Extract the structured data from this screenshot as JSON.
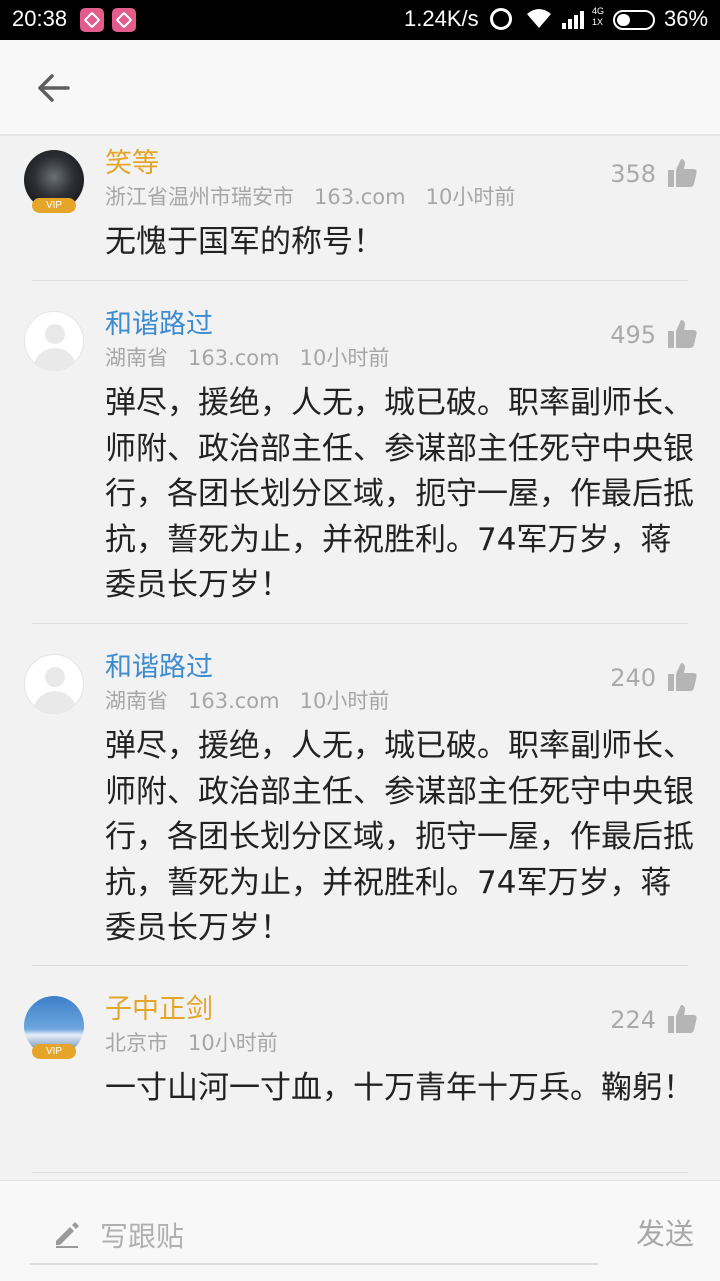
{
  "status_bar": {
    "time": "20:38",
    "net_speed": "1.24K/s",
    "network_type": "4G",
    "sim": "1X",
    "battery": "36%"
  },
  "header": {
    "back_icon": "arrow-left-icon"
  },
  "comments": [
    {
      "user": "笑等",
      "user_color": "#e5a52a",
      "vip": "VIP",
      "location": "浙江省温州市瑞安市",
      "source": "163.com",
      "time": "10小时前",
      "likes": "358",
      "text": "无愧于国军的称号！"
    },
    {
      "user": "和谐路过",
      "user_color": "#3e8cd0",
      "location": "湖南省",
      "source": "163.com",
      "time": "10小时前",
      "likes": "495",
      "text": "弹尽，援绝，人无，城已破。职率副师长、师附、政治部主任、参谋部主任死守中央银行，各团长划分区域，扼守一屋，作最后抵抗，誓死为止，并祝胜利。74军万岁，蒋委员长万岁！"
    },
    {
      "user": "和谐路过",
      "user_color": "#3e8cd0",
      "location": "湖南省",
      "source": "163.com",
      "time": "10小时前",
      "likes": "240",
      "text": "弹尽，援绝，人无，城已破。职率副师长、师附、政治部主任、参谋部主任死守中央银行，各团长划分区域，扼守一屋，作最后抵抗，誓死为止，并祝胜利。74军万岁，蒋委员长万岁！"
    },
    {
      "user": "子中正剑",
      "user_color": "#e5a52a",
      "vip": "VIP",
      "location": "北京市",
      "time": "10小时前",
      "likes": "224",
      "text": "一寸山河一寸血，十万青年十万兵。鞠躬！"
    }
  ],
  "reply_bar": {
    "placeholder": "写跟贴",
    "send_label": "发送",
    "pencil_icon": "pencil-icon"
  }
}
